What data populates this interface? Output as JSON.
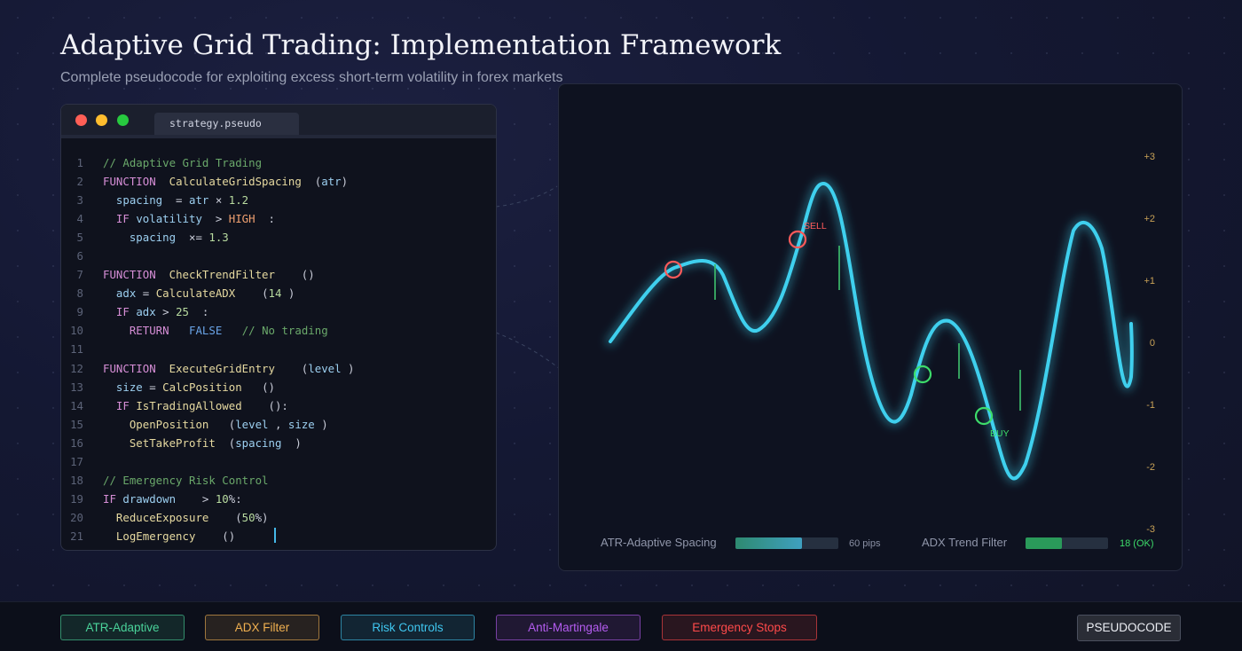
{
  "header": {
    "title": "Adaptive Grid Trading: Implementation Framework",
    "subtitle": "Complete pseudocode for exploiting excess short-term volatility in forex markets"
  },
  "editor": {
    "tab_label": "strategy.pseudo",
    "lines": [
      {
        "n": "1",
        "t": [
          [
            "// Adaptive Grid Trading",
            "cm"
          ]
        ]
      },
      {
        "n": "2",
        "t": [
          [
            "FUNCTION",
            "kw"
          ],
          [
            "  ",
            "op"
          ],
          [
            "CalculateGridSpacing",
            "fn"
          ],
          [
            "  (",
            "op"
          ],
          [
            "atr",
            "va"
          ],
          [
            ")",
            "op"
          ]
        ]
      },
      {
        "n": "3",
        "t": [
          [
            "  ",
            "op"
          ],
          [
            "spacing",
            "va"
          ],
          [
            "  = ",
            "op"
          ],
          [
            "atr",
            "va"
          ],
          [
            " × ",
            "op"
          ],
          [
            "1.2",
            "nu"
          ]
        ]
      },
      {
        "n": "4",
        "t": [
          [
            "  ",
            "op"
          ],
          [
            "IF",
            "kw"
          ],
          [
            " ",
            "op"
          ],
          [
            "volatility",
            "va"
          ],
          [
            "  > ",
            "op"
          ],
          [
            "HIGH",
            "co"
          ],
          [
            "  :",
            "op"
          ]
        ]
      },
      {
        "n": "5",
        "t": [
          [
            "    ",
            "op"
          ],
          [
            "spacing",
            "va"
          ],
          [
            "  ×= ",
            "op"
          ],
          [
            "1.3",
            "nu"
          ]
        ]
      },
      {
        "n": "6",
        "t": []
      },
      {
        "n": "7",
        "t": [
          [
            "FUNCTION",
            "kw"
          ],
          [
            "  ",
            "op"
          ],
          [
            "CheckTrendFilter",
            "fn"
          ],
          [
            "    ()",
            "op"
          ]
        ]
      },
      {
        "n": "8",
        "t": [
          [
            "  ",
            "op"
          ],
          [
            "adx",
            "va"
          ],
          [
            " = ",
            "op"
          ],
          [
            "CalculateADX",
            "fn"
          ],
          [
            "    (",
            "op"
          ],
          [
            "14",
            "nu"
          ],
          [
            " )",
            "op"
          ]
        ]
      },
      {
        "n": "9",
        "t": [
          [
            "  ",
            "op"
          ],
          [
            "IF",
            "kw"
          ],
          [
            " ",
            "op"
          ],
          [
            "adx",
            "va"
          ],
          [
            " > ",
            "op"
          ],
          [
            "25",
            "nu"
          ],
          [
            "  :",
            "op"
          ]
        ]
      },
      {
        "n": "10",
        "t": [
          [
            "    ",
            "op"
          ],
          [
            "RETURN",
            "kw"
          ],
          [
            "   ",
            "op"
          ],
          [
            "FALSE",
            "bo"
          ],
          [
            "   ",
            "op"
          ],
          [
            "// No trading",
            "cm"
          ]
        ]
      },
      {
        "n": "11",
        "t": []
      },
      {
        "n": "12",
        "t": [
          [
            "FUNCTION",
            "kw"
          ],
          [
            "  ",
            "op"
          ],
          [
            "ExecuteGridEntry",
            "fn"
          ],
          [
            "    (",
            "op"
          ],
          [
            "level",
            "va"
          ],
          [
            " )",
            "op"
          ]
        ]
      },
      {
        "n": "13",
        "t": [
          [
            "  ",
            "op"
          ],
          [
            "size",
            "va"
          ],
          [
            " = ",
            "op"
          ],
          [
            "CalcPosition",
            "fn"
          ],
          [
            "   ()",
            "op"
          ]
        ]
      },
      {
        "n": "14",
        "t": [
          [
            "  ",
            "op"
          ],
          [
            "IF",
            "kw"
          ],
          [
            " ",
            "op"
          ],
          [
            "IsTradingAllowed",
            "fn"
          ],
          [
            "    ():",
            "op"
          ]
        ]
      },
      {
        "n": "15",
        "t": [
          [
            "    ",
            "op"
          ],
          [
            "OpenPosition",
            "fn"
          ],
          [
            "   (",
            "op"
          ],
          [
            "level",
            "va"
          ],
          [
            " , ",
            "op"
          ],
          [
            "size",
            "va"
          ],
          [
            " )",
            "op"
          ]
        ]
      },
      {
        "n": "16",
        "t": [
          [
            "    ",
            "op"
          ],
          [
            "SetTakeProfit",
            "fn"
          ],
          [
            "  (",
            "op"
          ],
          [
            "spacing",
            "va"
          ],
          [
            "  )",
            "op"
          ]
        ]
      },
      {
        "n": "17",
        "t": []
      },
      {
        "n": "18",
        "t": [
          [
            "// Emergency Risk Control",
            "cm"
          ]
        ]
      },
      {
        "n": "19",
        "t": [
          [
            "IF",
            "kw"
          ],
          [
            " ",
            "op"
          ],
          [
            "drawdown",
            "va"
          ],
          [
            "    > ",
            "op"
          ],
          [
            "10",
            "nu"
          ],
          [
            "%:",
            "op"
          ]
        ]
      },
      {
        "n": "20",
        "t": [
          [
            "  ",
            "op"
          ],
          [
            "ReduceExposure",
            "fn"
          ],
          [
            "    (",
            "op"
          ],
          [
            "50",
            "nu"
          ],
          [
            "%)",
            "op"
          ]
        ]
      },
      {
        "n": "21",
        "t": [
          [
            "  ",
            "op"
          ],
          [
            "LogEmergency",
            "fn"
          ],
          [
            "    ()",
            "op"
          ]
        ]
      }
    ]
  },
  "chart": {
    "y_ticks": [
      "+3",
      "+2",
      "+1",
      "0",
      "-1",
      "-2",
      "-3"
    ],
    "markers": [
      {
        "label": "SELL",
        "color": "#ff5a5a"
      },
      {
        "label": "BUY",
        "color": "#3ddc6a"
      }
    ],
    "stats": {
      "atr_label": "ATR-Adaptive Spacing",
      "atr_value": "60 pips",
      "atr_fill": 0.65,
      "adx_label": "ADX Trend Filter",
      "adx_value": "18 (OK)",
      "adx_fill": 0.44
    },
    "colors": {
      "curve": "#3fd0ee",
      "sell": "#ff5a5a",
      "buy": "#3ddc6a",
      "tick": "#c9a257"
    }
  },
  "footer": {
    "chips": [
      {
        "label": "ATR-Adaptive",
        "color": "#4ad39a"
      },
      {
        "label": "ADX Filter",
        "color": "#f0b050"
      },
      {
        "label": "Risk Controls",
        "color": "#3fc6ef"
      },
      {
        "label": "Anti-Martingale",
        "color": "#b45cf0"
      },
      {
        "label": "Emergency Stops",
        "color": "#ff4a4a"
      }
    ],
    "pseudocode_label": "PSEUDOCODE"
  }
}
